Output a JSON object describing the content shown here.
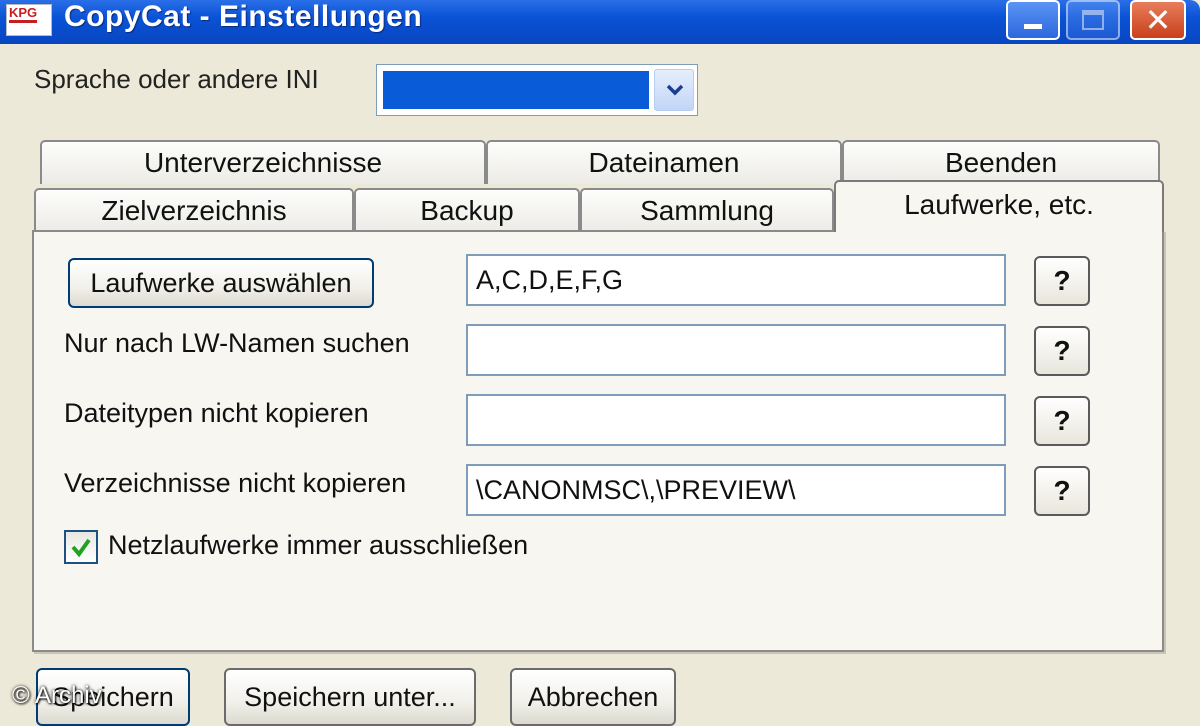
{
  "window": {
    "title": "CopyCat - Einstellungen",
    "app_icon_text": "KPG"
  },
  "language": {
    "label": "Sprache oder andere INI",
    "selected_value": ""
  },
  "tabs": {
    "row_top": [
      {
        "label": "Unterverzeichnisse"
      },
      {
        "label": "Dateinamen"
      },
      {
        "label": "Beenden"
      }
    ],
    "row_bottom": [
      {
        "label": "Zielverzeichnis"
      },
      {
        "label": "Backup"
      },
      {
        "label": "Sammlung"
      },
      {
        "label": "Laufwerke, etc."
      }
    ],
    "active": "Laufwerke, etc."
  },
  "panel": {
    "select_drives_button": "Laufwerke auswählen",
    "drives_value": "A,C,D,E,F,G",
    "label_name_search": "Nur nach LW-Namen suchen",
    "name_search_value": "",
    "label_filetypes": "Dateitypen nicht kopieren",
    "filetypes_value": "",
    "label_dirs": "Verzeichnisse nicht kopieren",
    "dirs_value": "\\CANONMSC\\,\\PREVIEW\\",
    "help_label": "?",
    "checkbox_label": "Netzlaufwerke immer ausschließen",
    "checkbox_checked": true
  },
  "footer": {
    "save_button": "Speichern",
    "save_as_button": "Speichern unter...",
    "cancel_button": "Abbrechen"
  },
  "watermark": "© Archiv",
  "colors": {
    "titlebar": "#0a52d6",
    "dialog_bg": "#ece9d8",
    "selection": "#0a5bd7",
    "checkmark": "#21a121",
    "close_button": "#c9401c"
  }
}
